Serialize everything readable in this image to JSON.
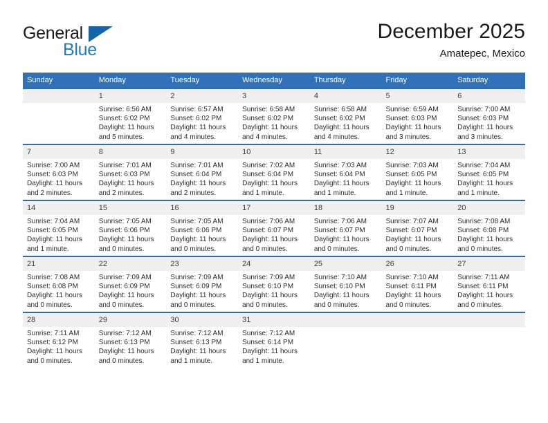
{
  "brand": {
    "name_part1": "General",
    "name_part2": "Blue",
    "flag_icon": "triangle-flag-icon"
  },
  "header": {
    "month_title": "December 2025",
    "location": "Amatepec, Mexico"
  },
  "theme": {
    "header_blue": "#3071b9",
    "row_rule_blue": "#2e6da8",
    "daynum_band": "#efefef",
    "brand_blue": "#1f7bc1",
    "text": "#2b2b2b"
  },
  "calendar": {
    "weekday_headers": [
      "Sunday",
      "Monday",
      "Tuesday",
      "Wednesday",
      "Thursday",
      "Friday",
      "Saturday"
    ],
    "weeks": [
      [
        {
          "day": "",
          "empty": true,
          "sunrise": "",
          "sunset": "",
          "daylight_line1": "",
          "daylight_line2": ""
        },
        {
          "day": "1",
          "empty": false,
          "sunrise": "Sunrise: 6:56 AM",
          "sunset": "Sunset: 6:02 PM",
          "daylight_line1": "Daylight: 11 hours",
          "daylight_line2": "and 5 minutes."
        },
        {
          "day": "2",
          "empty": false,
          "sunrise": "Sunrise: 6:57 AM",
          "sunset": "Sunset: 6:02 PM",
          "daylight_line1": "Daylight: 11 hours",
          "daylight_line2": "and 4 minutes."
        },
        {
          "day": "3",
          "empty": false,
          "sunrise": "Sunrise: 6:58 AM",
          "sunset": "Sunset: 6:02 PM",
          "daylight_line1": "Daylight: 11 hours",
          "daylight_line2": "and 4 minutes."
        },
        {
          "day": "4",
          "empty": false,
          "sunrise": "Sunrise: 6:58 AM",
          "sunset": "Sunset: 6:02 PM",
          "daylight_line1": "Daylight: 11 hours",
          "daylight_line2": "and 4 minutes."
        },
        {
          "day": "5",
          "empty": false,
          "sunrise": "Sunrise: 6:59 AM",
          "sunset": "Sunset: 6:03 PM",
          "daylight_line1": "Daylight: 11 hours",
          "daylight_line2": "and 3 minutes."
        },
        {
          "day": "6",
          "empty": false,
          "sunrise": "Sunrise: 7:00 AM",
          "sunset": "Sunset: 6:03 PM",
          "daylight_line1": "Daylight: 11 hours",
          "daylight_line2": "and 3 minutes."
        }
      ],
      [
        {
          "day": "7",
          "empty": false,
          "sunrise": "Sunrise: 7:00 AM",
          "sunset": "Sunset: 6:03 PM",
          "daylight_line1": "Daylight: 11 hours",
          "daylight_line2": "and 2 minutes."
        },
        {
          "day": "8",
          "empty": false,
          "sunrise": "Sunrise: 7:01 AM",
          "sunset": "Sunset: 6:03 PM",
          "daylight_line1": "Daylight: 11 hours",
          "daylight_line2": "and 2 minutes."
        },
        {
          "day": "9",
          "empty": false,
          "sunrise": "Sunrise: 7:01 AM",
          "sunset": "Sunset: 6:04 PM",
          "daylight_line1": "Daylight: 11 hours",
          "daylight_line2": "and 2 minutes."
        },
        {
          "day": "10",
          "empty": false,
          "sunrise": "Sunrise: 7:02 AM",
          "sunset": "Sunset: 6:04 PM",
          "daylight_line1": "Daylight: 11 hours",
          "daylight_line2": "and 1 minute."
        },
        {
          "day": "11",
          "empty": false,
          "sunrise": "Sunrise: 7:03 AM",
          "sunset": "Sunset: 6:04 PM",
          "daylight_line1": "Daylight: 11 hours",
          "daylight_line2": "and 1 minute."
        },
        {
          "day": "12",
          "empty": false,
          "sunrise": "Sunrise: 7:03 AM",
          "sunset": "Sunset: 6:05 PM",
          "daylight_line1": "Daylight: 11 hours",
          "daylight_line2": "and 1 minute."
        },
        {
          "day": "13",
          "empty": false,
          "sunrise": "Sunrise: 7:04 AM",
          "sunset": "Sunset: 6:05 PM",
          "daylight_line1": "Daylight: 11 hours",
          "daylight_line2": "and 1 minute."
        }
      ],
      [
        {
          "day": "14",
          "empty": false,
          "sunrise": "Sunrise: 7:04 AM",
          "sunset": "Sunset: 6:05 PM",
          "daylight_line1": "Daylight: 11 hours",
          "daylight_line2": "and 1 minute."
        },
        {
          "day": "15",
          "empty": false,
          "sunrise": "Sunrise: 7:05 AM",
          "sunset": "Sunset: 6:06 PM",
          "daylight_line1": "Daylight: 11 hours",
          "daylight_line2": "and 0 minutes."
        },
        {
          "day": "16",
          "empty": false,
          "sunrise": "Sunrise: 7:05 AM",
          "sunset": "Sunset: 6:06 PM",
          "daylight_line1": "Daylight: 11 hours",
          "daylight_line2": "and 0 minutes."
        },
        {
          "day": "17",
          "empty": false,
          "sunrise": "Sunrise: 7:06 AM",
          "sunset": "Sunset: 6:07 PM",
          "daylight_line1": "Daylight: 11 hours",
          "daylight_line2": "and 0 minutes."
        },
        {
          "day": "18",
          "empty": false,
          "sunrise": "Sunrise: 7:06 AM",
          "sunset": "Sunset: 6:07 PM",
          "daylight_line1": "Daylight: 11 hours",
          "daylight_line2": "and 0 minutes."
        },
        {
          "day": "19",
          "empty": false,
          "sunrise": "Sunrise: 7:07 AM",
          "sunset": "Sunset: 6:07 PM",
          "daylight_line1": "Daylight: 11 hours",
          "daylight_line2": "and 0 minutes."
        },
        {
          "day": "20",
          "empty": false,
          "sunrise": "Sunrise: 7:08 AM",
          "sunset": "Sunset: 6:08 PM",
          "daylight_line1": "Daylight: 11 hours",
          "daylight_line2": "and 0 minutes."
        }
      ],
      [
        {
          "day": "21",
          "empty": false,
          "sunrise": "Sunrise: 7:08 AM",
          "sunset": "Sunset: 6:08 PM",
          "daylight_line1": "Daylight: 11 hours",
          "daylight_line2": "and 0 minutes."
        },
        {
          "day": "22",
          "empty": false,
          "sunrise": "Sunrise: 7:09 AM",
          "sunset": "Sunset: 6:09 PM",
          "daylight_line1": "Daylight: 11 hours",
          "daylight_line2": "and 0 minutes."
        },
        {
          "day": "23",
          "empty": false,
          "sunrise": "Sunrise: 7:09 AM",
          "sunset": "Sunset: 6:09 PM",
          "daylight_line1": "Daylight: 11 hours",
          "daylight_line2": "and 0 minutes."
        },
        {
          "day": "24",
          "empty": false,
          "sunrise": "Sunrise: 7:09 AM",
          "sunset": "Sunset: 6:10 PM",
          "daylight_line1": "Daylight: 11 hours",
          "daylight_line2": "and 0 minutes."
        },
        {
          "day": "25",
          "empty": false,
          "sunrise": "Sunrise: 7:10 AM",
          "sunset": "Sunset: 6:10 PM",
          "daylight_line1": "Daylight: 11 hours",
          "daylight_line2": "and 0 minutes."
        },
        {
          "day": "26",
          "empty": false,
          "sunrise": "Sunrise: 7:10 AM",
          "sunset": "Sunset: 6:11 PM",
          "daylight_line1": "Daylight: 11 hours",
          "daylight_line2": "and 0 minutes."
        },
        {
          "day": "27",
          "empty": false,
          "sunrise": "Sunrise: 7:11 AM",
          "sunset": "Sunset: 6:11 PM",
          "daylight_line1": "Daylight: 11 hours",
          "daylight_line2": "and 0 minutes."
        }
      ],
      [
        {
          "day": "28",
          "empty": false,
          "sunrise": "Sunrise: 7:11 AM",
          "sunset": "Sunset: 6:12 PM",
          "daylight_line1": "Daylight: 11 hours",
          "daylight_line2": "and 0 minutes."
        },
        {
          "day": "29",
          "empty": false,
          "sunrise": "Sunrise: 7:12 AM",
          "sunset": "Sunset: 6:13 PM",
          "daylight_line1": "Daylight: 11 hours",
          "daylight_line2": "and 0 minutes."
        },
        {
          "day": "30",
          "empty": false,
          "sunrise": "Sunrise: 7:12 AM",
          "sunset": "Sunset: 6:13 PM",
          "daylight_line1": "Daylight: 11 hours",
          "daylight_line2": "and 1 minute."
        },
        {
          "day": "31",
          "empty": false,
          "sunrise": "Sunrise: 7:12 AM",
          "sunset": "Sunset: 6:14 PM",
          "daylight_line1": "Daylight: 11 hours",
          "daylight_line2": "and 1 minute."
        },
        {
          "day": "",
          "empty": true,
          "sunrise": "",
          "sunset": "",
          "daylight_line1": "",
          "daylight_line2": ""
        },
        {
          "day": "",
          "empty": true,
          "sunrise": "",
          "sunset": "",
          "daylight_line1": "",
          "daylight_line2": ""
        },
        {
          "day": "",
          "empty": true,
          "sunrise": "",
          "sunset": "",
          "daylight_line1": "",
          "daylight_line2": ""
        }
      ]
    ]
  }
}
